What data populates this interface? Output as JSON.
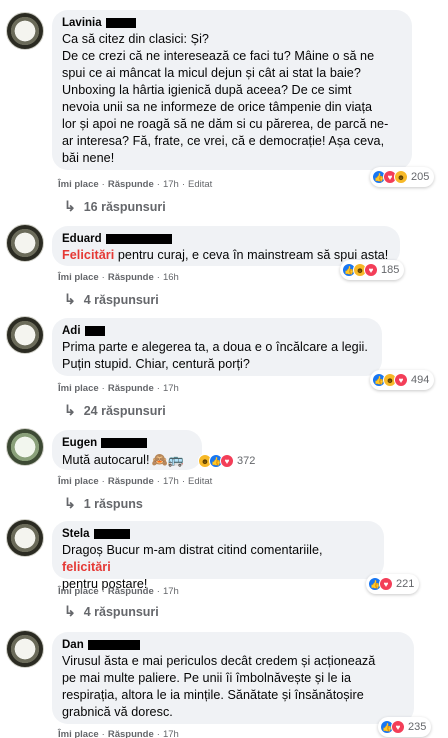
{
  "colors": {
    "bubble": "#f0f2f5",
    "highlight": "#e53935",
    "meta": "#65676b",
    "like": "#1877f2"
  },
  "labels": {
    "like": "Îmi place",
    "reply": "Răspunde",
    "dot": "·"
  },
  "comments": [
    {
      "name": "Lavinia",
      "text": "Ca să citez din clasici: Și?\nDe ce crezi că ne interesează ce faci tu? Mâine o să ne\nspui ce ai mâncat la micul dejun și cât ai stat la baie?\nUnboxing la hârtia igienică după aceea? De ce simt\nnevoia unii sa ne informeze de orice tâmpenie din viața\nlor și apoi ne roagă să ne dăm si cu părerea, de parcă ne-\nar interesa? Fă, frate, ce vrei, că e democrație! Așa ceva,\nbăi nene!",
      "time": "17h",
      "edited": "Editat",
      "reactions": {
        "icons": [
          "like-icon",
          "love-icon",
          "haha-icon"
        ],
        "count": "205"
      },
      "replies": "16 răspunsuri"
    },
    {
      "name": "Eduard",
      "text_highlight": "Felicitări",
      "text_rest": " pentru curaj, e ceva în mainstream să spui asta!",
      "time": "16h",
      "reactions": {
        "icons": [
          "like-icon",
          "haha-icon",
          "love-icon"
        ],
        "count": "185"
      },
      "replies": "4 răspunsuri"
    },
    {
      "name": "Adi",
      "text": "Prima parte e alegerea ta, a doua e o încălcare a legii.\nPuțin stupid. Chiar, centură porți?",
      "time": "17h",
      "reactions": {
        "icons": [
          "like-icon",
          "haha-icon",
          "love-icon"
        ],
        "count": "494"
      },
      "replies": "24 răspunsuri"
    },
    {
      "name": "Eugen",
      "text": "Mută autocarul!",
      "emoji": "🙈🚌",
      "time": "17h",
      "edited": "Editat",
      "reactions": {
        "icons": [
          "haha-icon",
          "like-icon",
          "love-icon"
        ],
        "count": "372"
      },
      "replies": "1 răspuns"
    },
    {
      "name": "Stela",
      "text_prefix": "Dragoș Bucur m-am distrat citind comentariile, ",
      "text_highlight": "felicitări",
      "text_suffix": "\npentru postare!",
      "time": "17h",
      "reactions": {
        "icons": [
          "like-icon",
          "love-icon"
        ],
        "count": "221"
      },
      "replies": "4 răspunsuri"
    },
    {
      "name": "Dan",
      "text": "Virusul ăsta e mai periculos decât credem și acționează\npe mai multe paliere. Pe unii îi îmbolnăvește și le ia\nrespirația, altora le ia mințile. Sănătate și însănătoșire\ngrabnică vă doresc.",
      "time": "17h",
      "reactions": {
        "icons": [
          "like-icon",
          "love-icon"
        ],
        "count": "235"
      }
    }
  ]
}
